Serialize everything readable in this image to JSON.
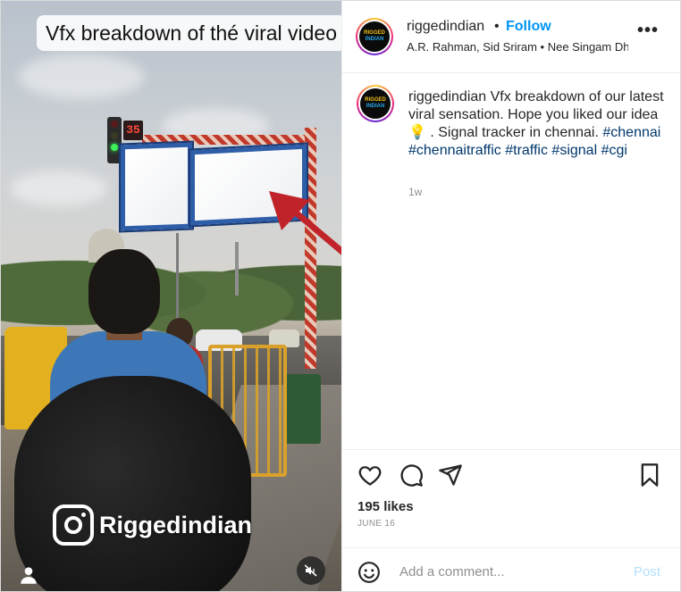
{
  "video": {
    "caption": "Vfx breakdown of thé viral video",
    "timer": "35",
    "watermark": "Riggedindian"
  },
  "header": {
    "username": "riggedindian",
    "separator": "•",
    "follow_label": "Follow",
    "audio": "A.R. Rahman, Sid Sriram • Nee Singam Dh",
    "more_label": "•••"
  },
  "avatar": {
    "line1": "RIGGED",
    "line2": "INDIAN"
  },
  "post_caption": {
    "username": "riggedindian",
    "text_before_emoji": " Vfx breakdown of our latest viral sensation. Hope you liked our idea ",
    "emoji": "💡",
    "text_after_emoji": " . Signal tracker in chennai.",
    "hashtags": [
      "#chennai",
      "#chennaitraffic",
      "#traffic",
      "#signal",
      "#cgi"
    ],
    "time": "1w"
  },
  "engagement": {
    "likes": "195 likes",
    "date": "JUNE 16"
  },
  "comment_box": {
    "placeholder": "Add a comment...",
    "post_label": "Post"
  },
  "colors": {
    "follow": "#0095f6",
    "hashtag": "#00376b",
    "post_disabled": "#b2dffc",
    "arrow": "#c0242a"
  },
  "icons": [
    "heart-icon",
    "comment-icon",
    "share-icon",
    "bookmark-icon",
    "emoji-icon",
    "mute-icon",
    "user-tag-icon",
    "instagram-icon",
    "more-icon"
  ]
}
